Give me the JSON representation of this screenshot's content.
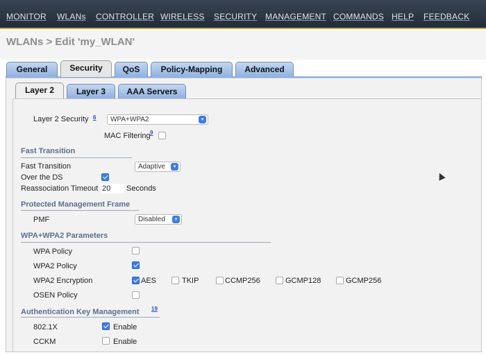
{
  "top_menu": [
    "MONITOR",
    "WLANs",
    "CONTROLLER",
    "WIRELESS",
    "SECURITY",
    "MANAGEMENT",
    "COMMANDS",
    "HELP",
    "FEEDBACK"
  ],
  "page_title": "WLANs > Edit  'my_WLAN'",
  "tabs": [
    "General",
    "Security",
    "QoS",
    "Policy-Mapping",
    "Advanced"
  ],
  "active_tab": "Security",
  "subtabs": [
    "Layer 2",
    "Layer 3",
    "AAA Servers"
  ],
  "active_subtab": "Layer 2",
  "layer2": {
    "security_label": "Layer 2 Security",
    "security_help": "6",
    "security_value": "WPA+WPA2",
    "mac_filtering_label": "MAC Filtering",
    "mac_filtering_help": "9"
  },
  "fast_transition": {
    "heading": "Fast Transition",
    "label": "Fast Transition",
    "value": "Adaptive",
    "over_ds_label": "Over the DS",
    "over_ds_checked": true,
    "reassoc_label": "Reassociation Timeout",
    "reassoc_value": "20",
    "reassoc_unit": "Seconds"
  },
  "pmf": {
    "heading": "Protected Management Frame",
    "label": "PMF",
    "value": "Disabled"
  },
  "wpa": {
    "heading": "WPA+WPA2 Parameters",
    "wpa_policy_label": "WPA Policy",
    "wpa2_policy_label": "WPA2 Policy",
    "wpa2_encryption_label": "WPA2 Encryption",
    "ciphers": [
      "AES",
      "TKIP",
      "CCMP256",
      "GCMP128",
      "GCMP256"
    ],
    "osen_label": "OSEN Policy"
  },
  "akm": {
    "heading": "Authentication Key Management",
    "help": "19",
    "rows": [
      {
        "label": "802.1X",
        "enable": "Enable"
      },
      {
        "label": "CCKM",
        "enable": "Enable"
      }
    ]
  },
  "colors": {
    "menu_bg": "#222b38",
    "tab_blue": "#8fb2e1",
    "section_text": "#5a6f8e",
    "checkbox_checked": "#3d7de8"
  }
}
